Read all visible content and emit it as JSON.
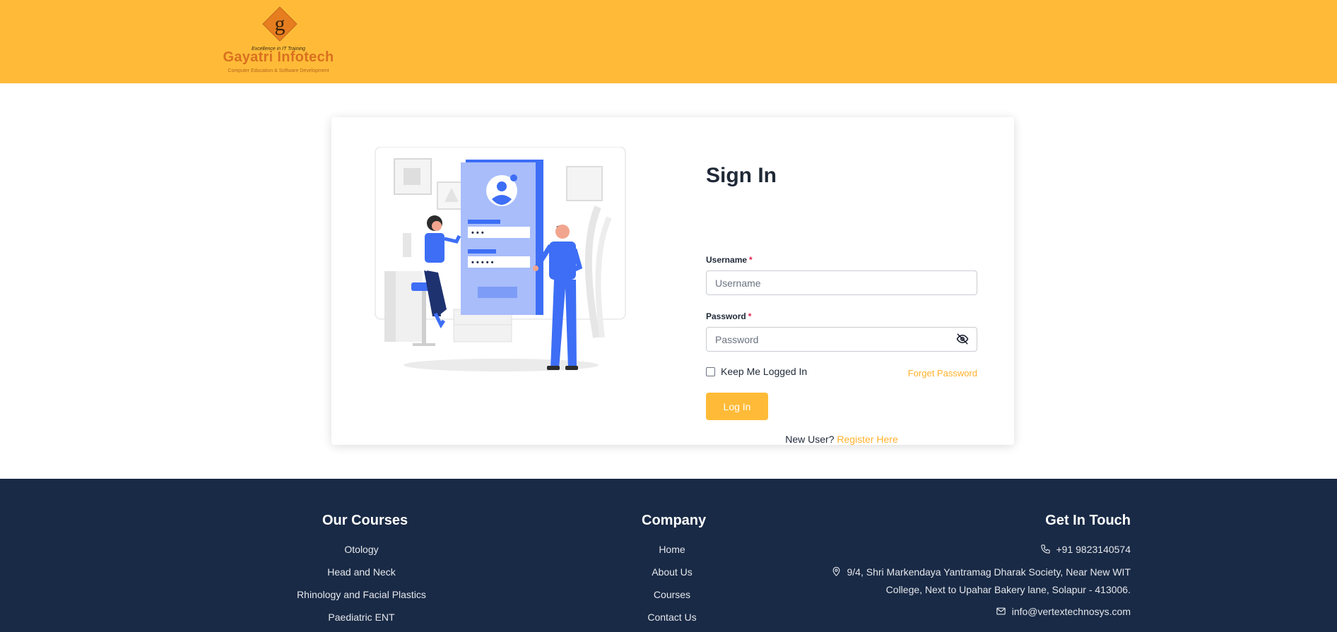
{
  "header": {
    "logo_monogram": "g",
    "logo_tagline": "Excellence in IT Training",
    "logo_brand": "Gayatri Infotech",
    "logo_sub": "Computer Education & Software Development",
    "background_color": "#ffbb38"
  },
  "login": {
    "title": "Sign In",
    "username_label": "Username",
    "username_placeholder": "Username",
    "password_label": "Password",
    "password_placeholder": "Password",
    "required_mark": "*",
    "keep_logged_in": "Keep Me Logged In",
    "forget_password": "Forget Password",
    "login_button": "Log In",
    "new_user_text": "New User?",
    "register_link": "Register Here",
    "illustration_dots_1": "• • •",
    "illustration_dots_2": "• • • • •"
  },
  "footer": {
    "courses_heading": "Our Courses",
    "courses": [
      "Otology",
      "Head and Neck",
      "Rhinology and Facial Plastics",
      "Paediatric ENT"
    ],
    "company_heading": "Company",
    "company_links": [
      "Home",
      "About Us",
      "Courses",
      "Contact Us"
    ],
    "contact_heading": "Get In Touch",
    "phone": "+91 9823140574",
    "address_line1": "9/4, Shri Markendaya Yantramag Dharak Society, Near New WIT",
    "address_line2": "College, Next to Upahar Bakery lane, Solapur - 413006.",
    "email": "info@vertextechnosys.com",
    "background_color": "#192a46"
  },
  "colors": {
    "accent": "#ffbb38",
    "link": "#ffb12b",
    "illustration_blue": "#3d6ef5"
  },
  "icons": [
    "phone-icon",
    "location-icon",
    "mail-icon",
    "eye-off-icon"
  ]
}
